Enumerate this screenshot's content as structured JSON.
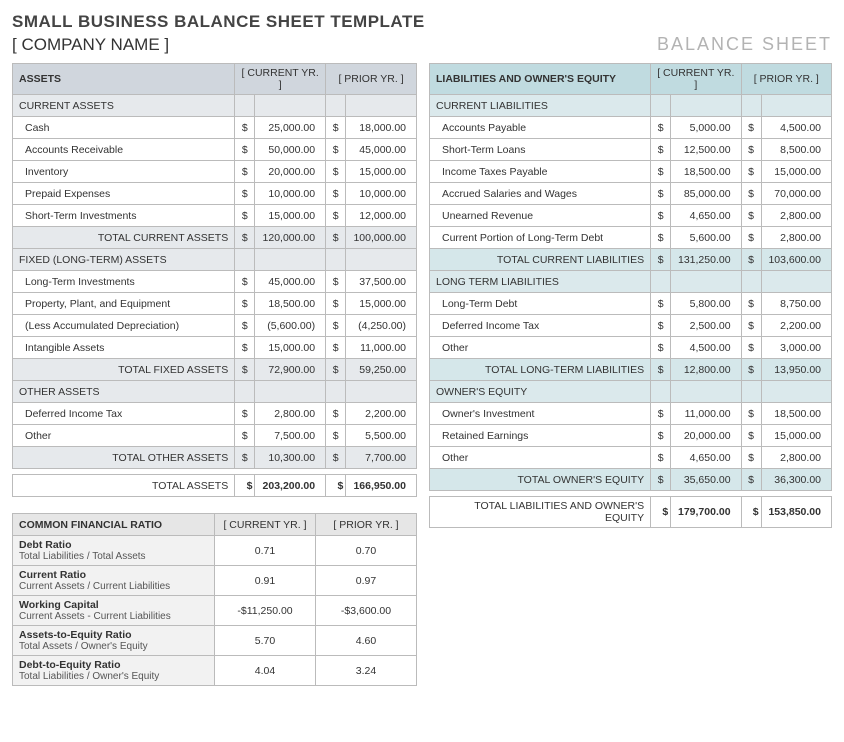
{
  "title": "SMALL BUSINESS BALANCE SHEET TEMPLATE",
  "company": "[ COMPANY NAME ]",
  "sheet_label": "BALANCE SHEET",
  "col_cur": "[ CURRENT YR. ]",
  "col_prior": "[ PRIOR YR. ]",
  "dollar": "$",
  "assets": {
    "header": "ASSETS",
    "sections": [
      {
        "name": "CURRENT ASSETS",
        "items": [
          {
            "label": "Cash",
            "cur": "25,000.00",
            "prior": "18,000.00"
          },
          {
            "label": "Accounts Receivable",
            "cur": "50,000.00",
            "prior": "45,000.00"
          },
          {
            "label": "Inventory",
            "cur": "20,000.00",
            "prior": "15,000.00"
          },
          {
            "label": "Prepaid Expenses",
            "cur": "10,000.00",
            "prior": "10,000.00"
          },
          {
            "label": "Short-Term Investments",
            "cur": "15,000.00",
            "prior": "12,000.00"
          }
        ],
        "subtotal": {
          "label": "TOTAL CURRENT ASSETS",
          "cur": "120,000.00",
          "prior": "100,000.00"
        }
      },
      {
        "name": "FIXED (LONG-TERM) ASSETS",
        "items": [
          {
            "label": "Long-Term Investments",
            "cur": "45,000.00",
            "prior": "37,500.00"
          },
          {
            "label": "Property, Plant, and Equipment",
            "cur": "18,500.00",
            "prior": "15,000.00"
          },
          {
            "label": "(Less Accumulated Depreciation)",
            "cur": "(5,600.00)",
            "prior": "(4,250.00)"
          },
          {
            "label": "Intangible Assets",
            "cur": "15,000.00",
            "prior": "11,000.00"
          }
        ],
        "subtotal": {
          "label": "TOTAL FIXED ASSETS",
          "cur": "72,900.00",
          "prior": "59,250.00"
        }
      },
      {
        "name": "OTHER ASSETS",
        "items": [
          {
            "label": "Deferred Income Tax",
            "cur": "2,800.00",
            "prior": "2,200.00"
          },
          {
            "label": "Other",
            "cur": "7,500.00",
            "prior": "5,500.00"
          }
        ],
        "subtotal": {
          "label": "TOTAL OTHER ASSETS",
          "cur": "10,300.00",
          "prior": "7,700.00"
        }
      }
    ],
    "grand": {
      "label": "TOTAL ASSETS",
      "cur": "203,200.00",
      "prior": "166,950.00"
    }
  },
  "liabilities": {
    "header": "LIABILITIES AND OWNER'S EQUITY",
    "sections": [
      {
        "name": "CURRENT LIABILITIES",
        "items": [
          {
            "label": "Accounts Payable",
            "cur": "5,000.00",
            "prior": "4,500.00"
          },
          {
            "label": "Short-Term Loans",
            "cur": "12,500.00",
            "prior": "8,500.00"
          },
          {
            "label": "Income Taxes Payable",
            "cur": "18,500.00",
            "prior": "15,000.00"
          },
          {
            "label": "Accrued Salaries and Wages",
            "cur": "85,000.00",
            "prior": "70,000.00"
          },
          {
            "label": "Unearned Revenue",
            "cur": "4,650.00",
            "prior": "2,800.00"
          },
          {
            "label": "Current Portion of Long-Term Debt",
            "cur": "5,600.00",
            "prior": "2,800.00"
          }
        ],
        "subtotal": {
          "label": "TOTAL CURRENT LIABILITIES",
          "cur": "131,250.00",
          "prior": "103,600.00"
        }
      },
      {
        "name": "LONG TERM LIABILITIES",
        "items": [
          {
            "label": "Long-Term Debt",
            "cur": "5,800.00",
            "prior": "8,750.00"
          },
          {
            "label": "Deferred Income Tax",
            "cur": "2,500.00",
            "prior": "2,200.00"
          },
          {
            "label": "Other",
            "cur": "4,500.00",
            "prior": "3,000.00"
          }
        ],
        "subtotal": {
          "label": "TOTAL LONG-TERM LIABILITIES",
          "cur": "12,800.00",
          "prior": "13,950.00"
        }
      },
      {
        "name": "OWNER'S EQUITY",
        "items": [
          {
            "label": "Owner's Investment",
            "cur": "11,000.00",
            "prior": "18,500.00"
          },
          {
            "label": "Retained Earnings",
            "cur": "20,000.00",
            "prior": "15,000.00"
          },
          {
            "label": "Other",
            "cur": "4,650.00",
            "prior": "2,800.00"
          }
        ],
        "subtotal": {
          "label": "TOTAL OWNER'S EQUITY",
          "cur": "35,650.00",
          "prior": "36,300.00"
        }
      }
    ],
    "grand": {
      "label": "TOTAL LIABILITIES AND OWNER'S EQUITY",
      "cur": "179,700.00",
      "prior": "153,850.00"
    }
  },
  "ratios": {
    "header": "COMMON FINANCIAL RATIO",
    "rows": [
      {
        "name": "Debt Ratio",
        "desc": "Total Liabilities / Total Assets",
        "cur": "0.71",
        "prior": "0.70"
      },
      {
        "name": "Current Ratio",
        "desc": "Current Assets / Current Liabilities",
        "cur": "0.91",
        "prior": "0.97"
      },
      {
        "name": "Working Capital",
        "desc": "Current Assets - Current Liabilities",
        "cur": "-$11,250.00",
        "prior": "-$3,600.00"
      },
      {
        "name": "Assets-to-Equity Ratio",
        "desc": "Total Assets / Owner's Equity",
        "cur": "5.70",
        "prior": "4.60"
      },
      {
        "name": "Debt-to-Equity Ratio",
        "desc": "Total Liabilities / Owner's Equity",
        "cur": "4.04",
        "prior": "3.24"
      }
    ]
  }
}
